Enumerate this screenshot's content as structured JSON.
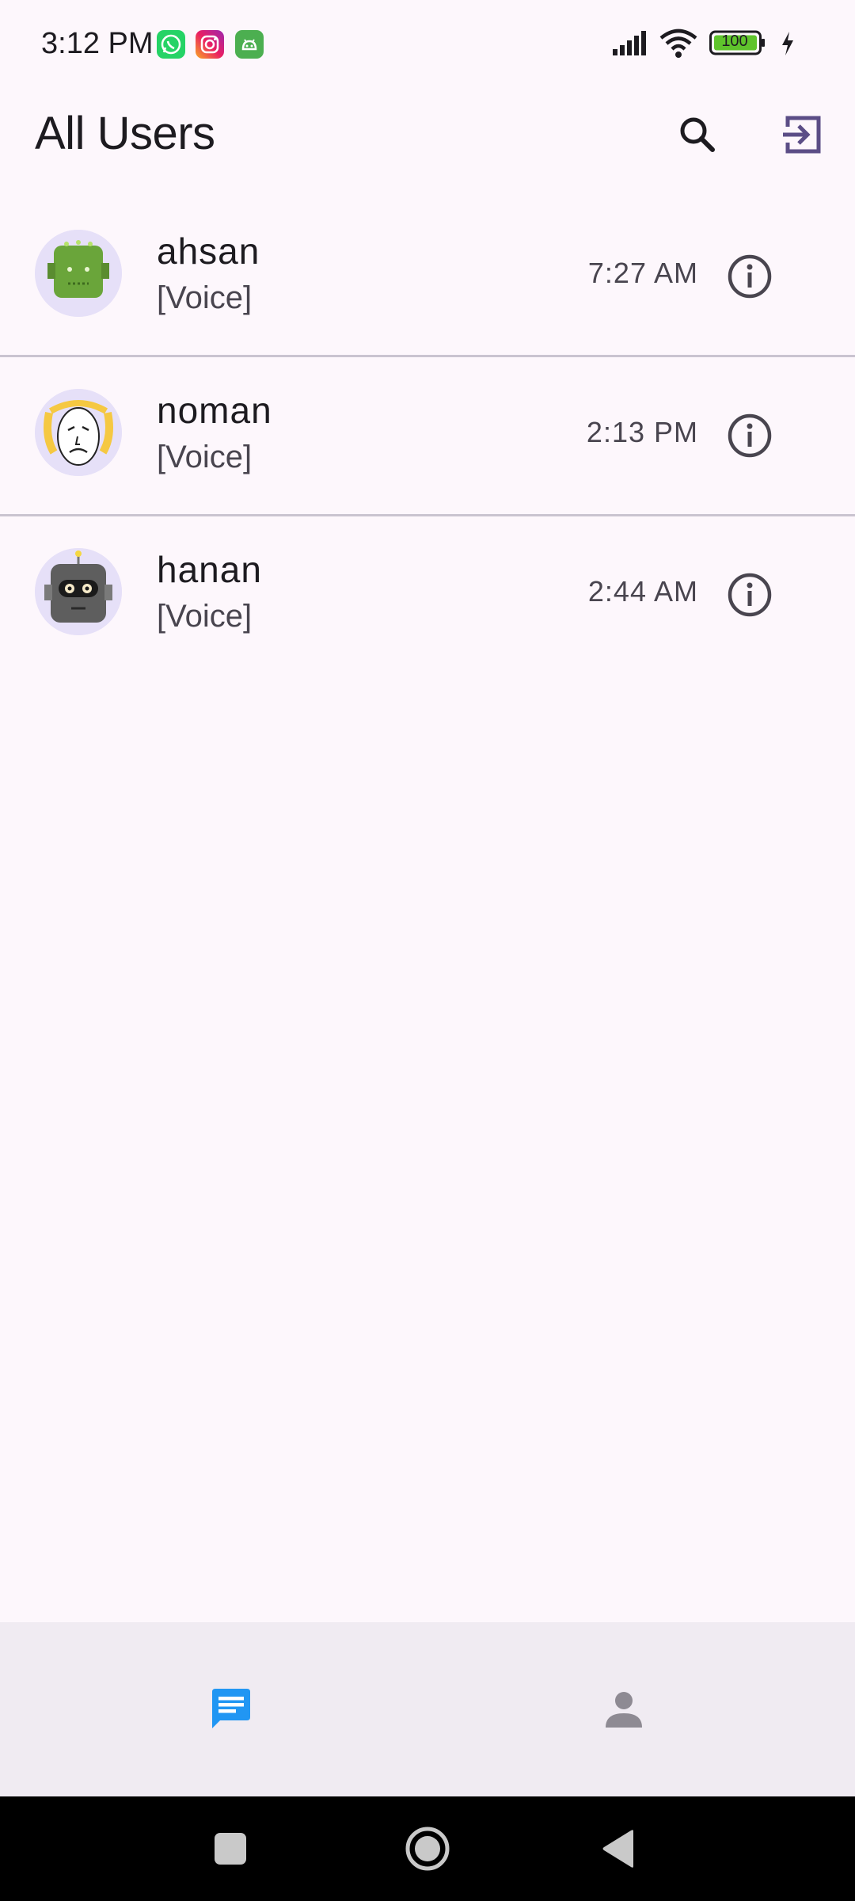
{
  "status_bar": {
    "time": "3:12 PM",
    "battery": "100",
    "notification_icons": [
      "whatsapp-icon",
      "instagram-icon",
      "android-app-icon"
    ]
  },
  "app_bar": {
    "title": "All Users",
    "actions": [
      "search-icon",
      "logout-icon"
    ]
  },
  "users": [
    {
      "name": "ahsan",
      "subtitle": "[Voice]",
      "time": "7:27 AM",
      "avatar": "green-robot-avatar"
    },
    {
      "name": "noman",
      "subtitle": "[Voice]",
      "time": "2:13 PM",
      "avatar": "blonde-sad-face-avatar"
    },
    {
      "name": "hanan",
      "subtitle": "[Voice]",
      "time": "2:44 AM",
      "avatar": "gray-robot-avatar"
    }
  ],
  "bottom_nav": {
    "items": [
      {
        "icon": "chat-icon",
        "selected": true
      },
      {
        "icon": "person-icon",
        "selected": false
      }
    ]
  },
  "colors": {
    "background": "#fdf7fc",
    "accent": "#2196f3",
    "icon_muted": "#49454f",
    "nav_background": "#f0ebf2",
    "divider": "#cac4d0"
  }
}
